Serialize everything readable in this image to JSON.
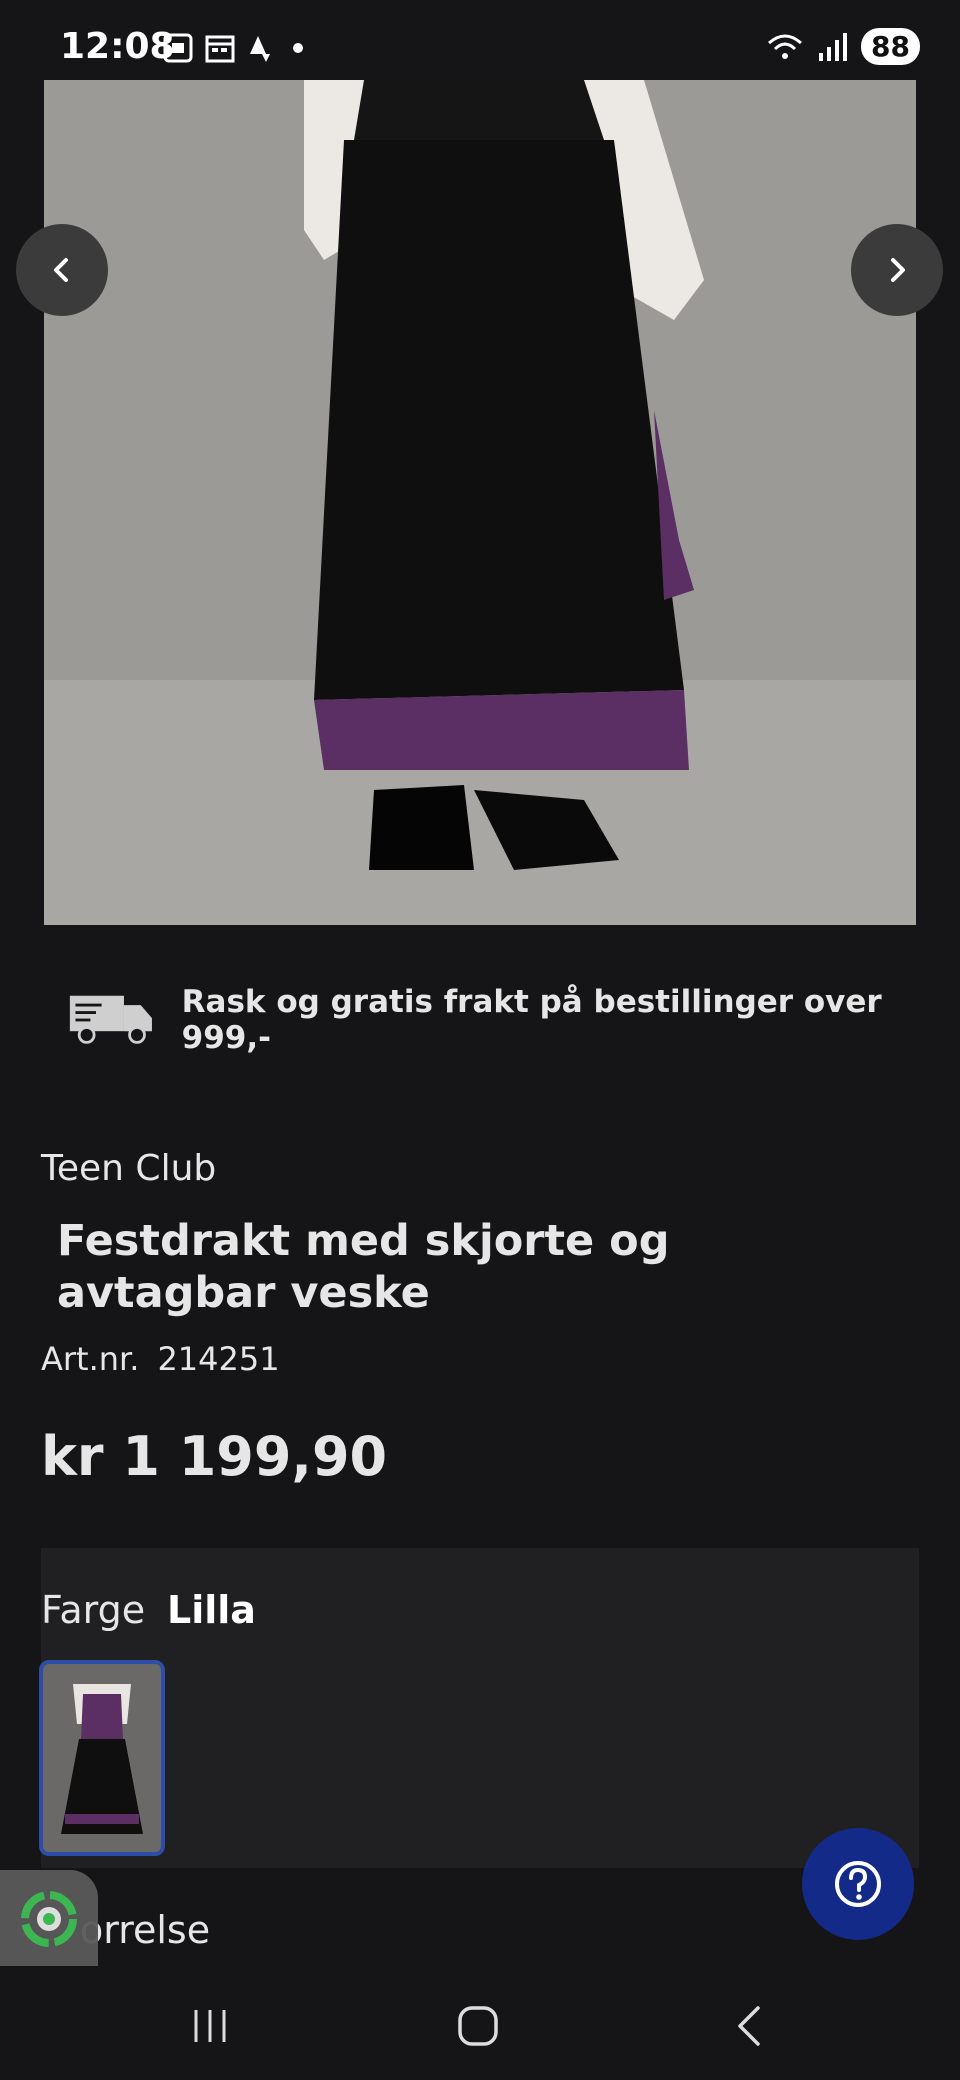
{
  "status": {
    "time": "12:08",
    "battery": "88"
  },
  "shipping": {
    "text": "Rask og gratis frakt på bestillinger over 999,-"
  },
  "product": {
    "brand": "Teen Club",
    "title": "Festdrakt med skjorte og avtagbar veske",
    "art_label": "Art.nr.",
    "art_number": "214251",
    "price": "kr 1 199,90"
  },
  "color": {
    "label": "Farge",
    "value": "Lilla"
  },
  "size": {
    "label": "orrelse"
  },
  "colors": {
    "accent": "#142a88",
    "swatch_border": "#2d4da8",
    "background": "#151517"
  },
  "icons": [
    "prev-arrow-icon",
    "next-arrow-icon",
    "truck-icon",
    "help-icon",
    "recycle-icon"
  ]
}
